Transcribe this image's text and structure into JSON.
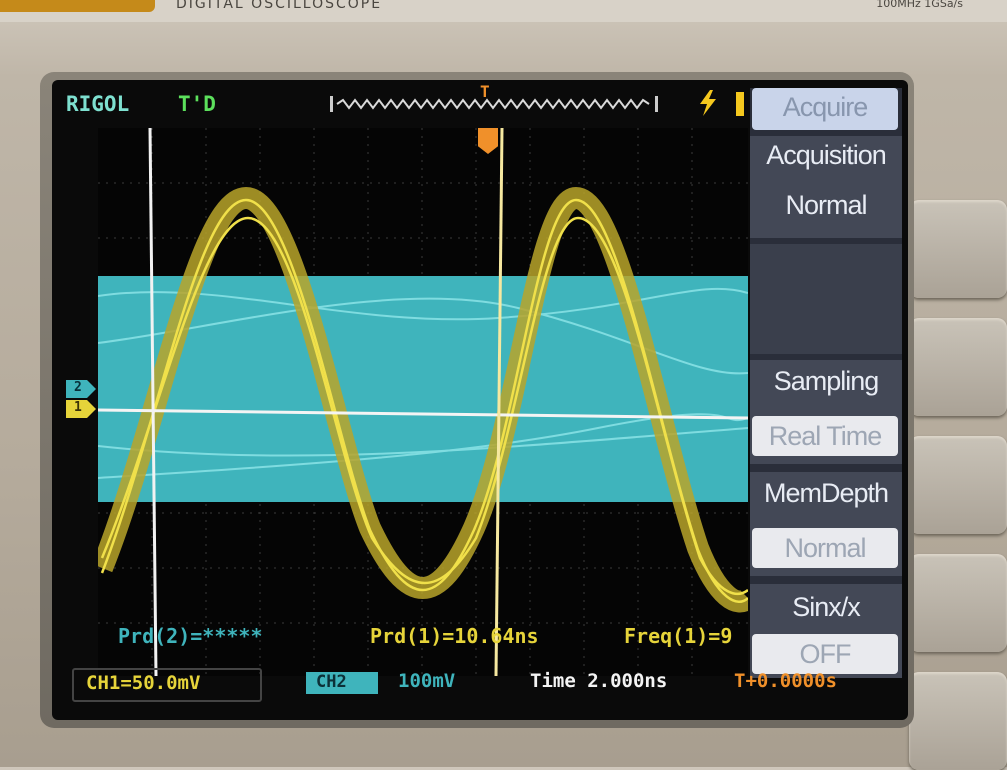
{
  "device": {
    "model_text": "DIGITAL OSCILLOSCOPE",
    "spec_text": "100MHz 1GSa/s"
  },
  "status_bar": {
    "brand": "RIGOL",
    "trigger_status": "T'D",
    "trigger_marker": "T"
  },
  "menu": {
    "title": "Acquire",
    "items": [
      {
        "label": "Acquisition",
        "value": "Normal"
      },
      {
        "label": "",
        "value": ""
      },
      {
        "label": "Sampling",
        "value": "Real Time"
      },
      {
        "label": "MemDepth",
        "value": "Normal"
      },
      {
        "label": "Sinx/x",
        "value": "OFF"
      }
    ]
  },
  "channel_markers": {
    "ch1": "1",
    "ch2": "2"
  },
  "measurements": {
    "prd2": "Prd(2)=*****",
    "prd1": "Prd(1)=10.64ns",
    "freq1": "Freq(1)=9"
  },
  "bottom_bar": {
    "ch1": "CH1=50.0mV",
    "ch2_label": "CH2",
    "ch2_scale": "100mV",
    "timebase": "Time 2.000ns",
    "trigger_offset": "T+0.0000s"
  },
  "colors": {
    "ch1": "#e6d43a",
    "ch2": "#3fb4bc",
    "menu_bg": "#2a2e3a",
    "status_label": "#7ee0d0",
    "trigger_marker": "#f0902a"
  }
}
